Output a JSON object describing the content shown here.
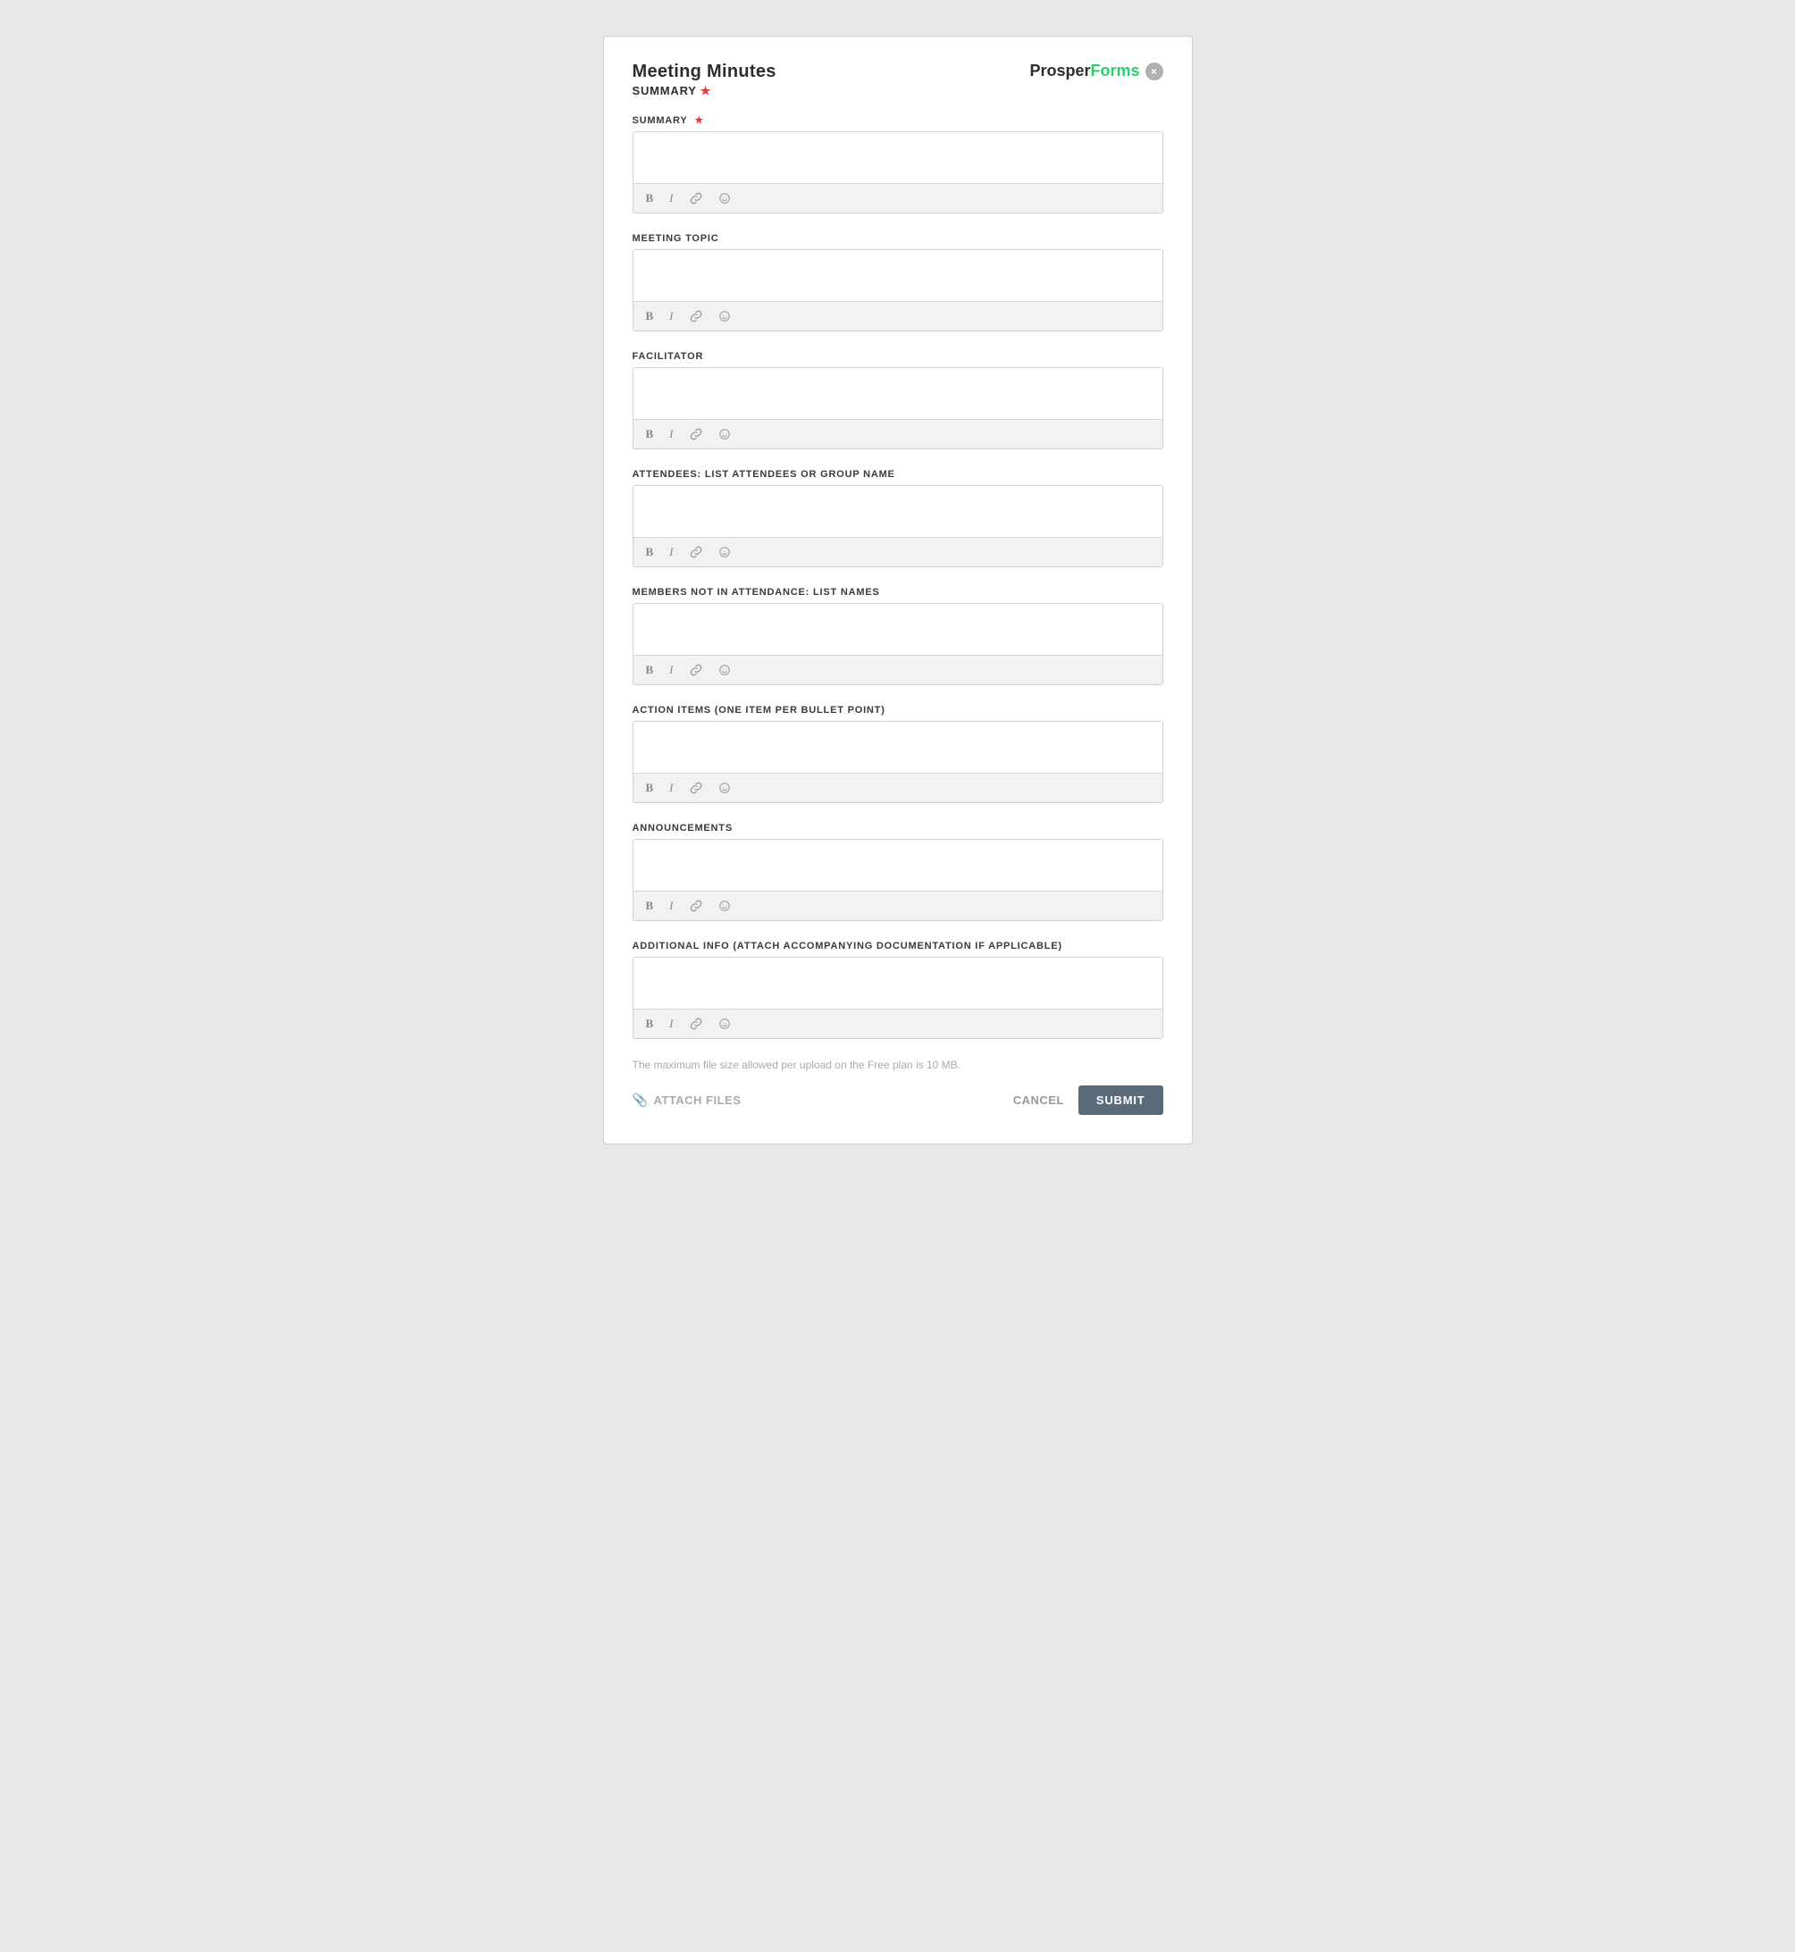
{
  "header": {
    "title": "Meeting Minutes",
    "subtitle": "SUMMARY",
    "required_indicator": "★",
    "logo_prosper": "Prosper",
    "logo_forms": "Forms",
    "close_label": "×"
  },
  "fields": [
    {
      "id": "summary",
      "label": "SUMMARY",
      "required": true,
      "placeholder": ""
    },
    {
      "id": "meeting-topic",
      "label": "MEETING TOPIC",
      "required": false,
      "placeholder": ""
    },
    {
      "id": "facilitator",
      "label": "FACILITATOR",
      "required": false,
      "placeholder": ""
    },
    {
      "id": "attendees",
      "label": "ATTENDEES: LIST ATTENDEES OR GROUP NAME",
      "required": false,
      "placeholder": ""
    },
    {
      "id": "members-not-attending",
      "label": "MEMBERS NOT IN ATTENDANCE: LIST NAMES",
      "required": false,
      "placeholder": ""
    },
    {
      "id": "action-items",
      "label": "ACTION ITEMS (ONE ITEM PER BULLET POINT)",
      "required": false,
      "placeholder": ""
    },
    {
      "id": "announcements",
      "label": "ANNOUNCEMENTS",
      "required": false,
      "placeholder": ""
    },
    {
      "id": "additional-info",
      "label": "ADDITIONAL INFO (ATTACH ACCOMPANYING DOCUMENTATION IF APPLICABLE)",
      "required": false,
      "placeholder": ""
    }
  ],
  "toolbar": {
    "bold": "B",
    "italic": "I"
  },
  "footer": {
    "file_size_note": "The maximum file size allowed per upload on the Free plan is 10 MB.",
    "attach_label": "ATTACH FILES",
    "cancel_label": "CANCEL",
    "submit_label": "SUBMIT"
  }
}
